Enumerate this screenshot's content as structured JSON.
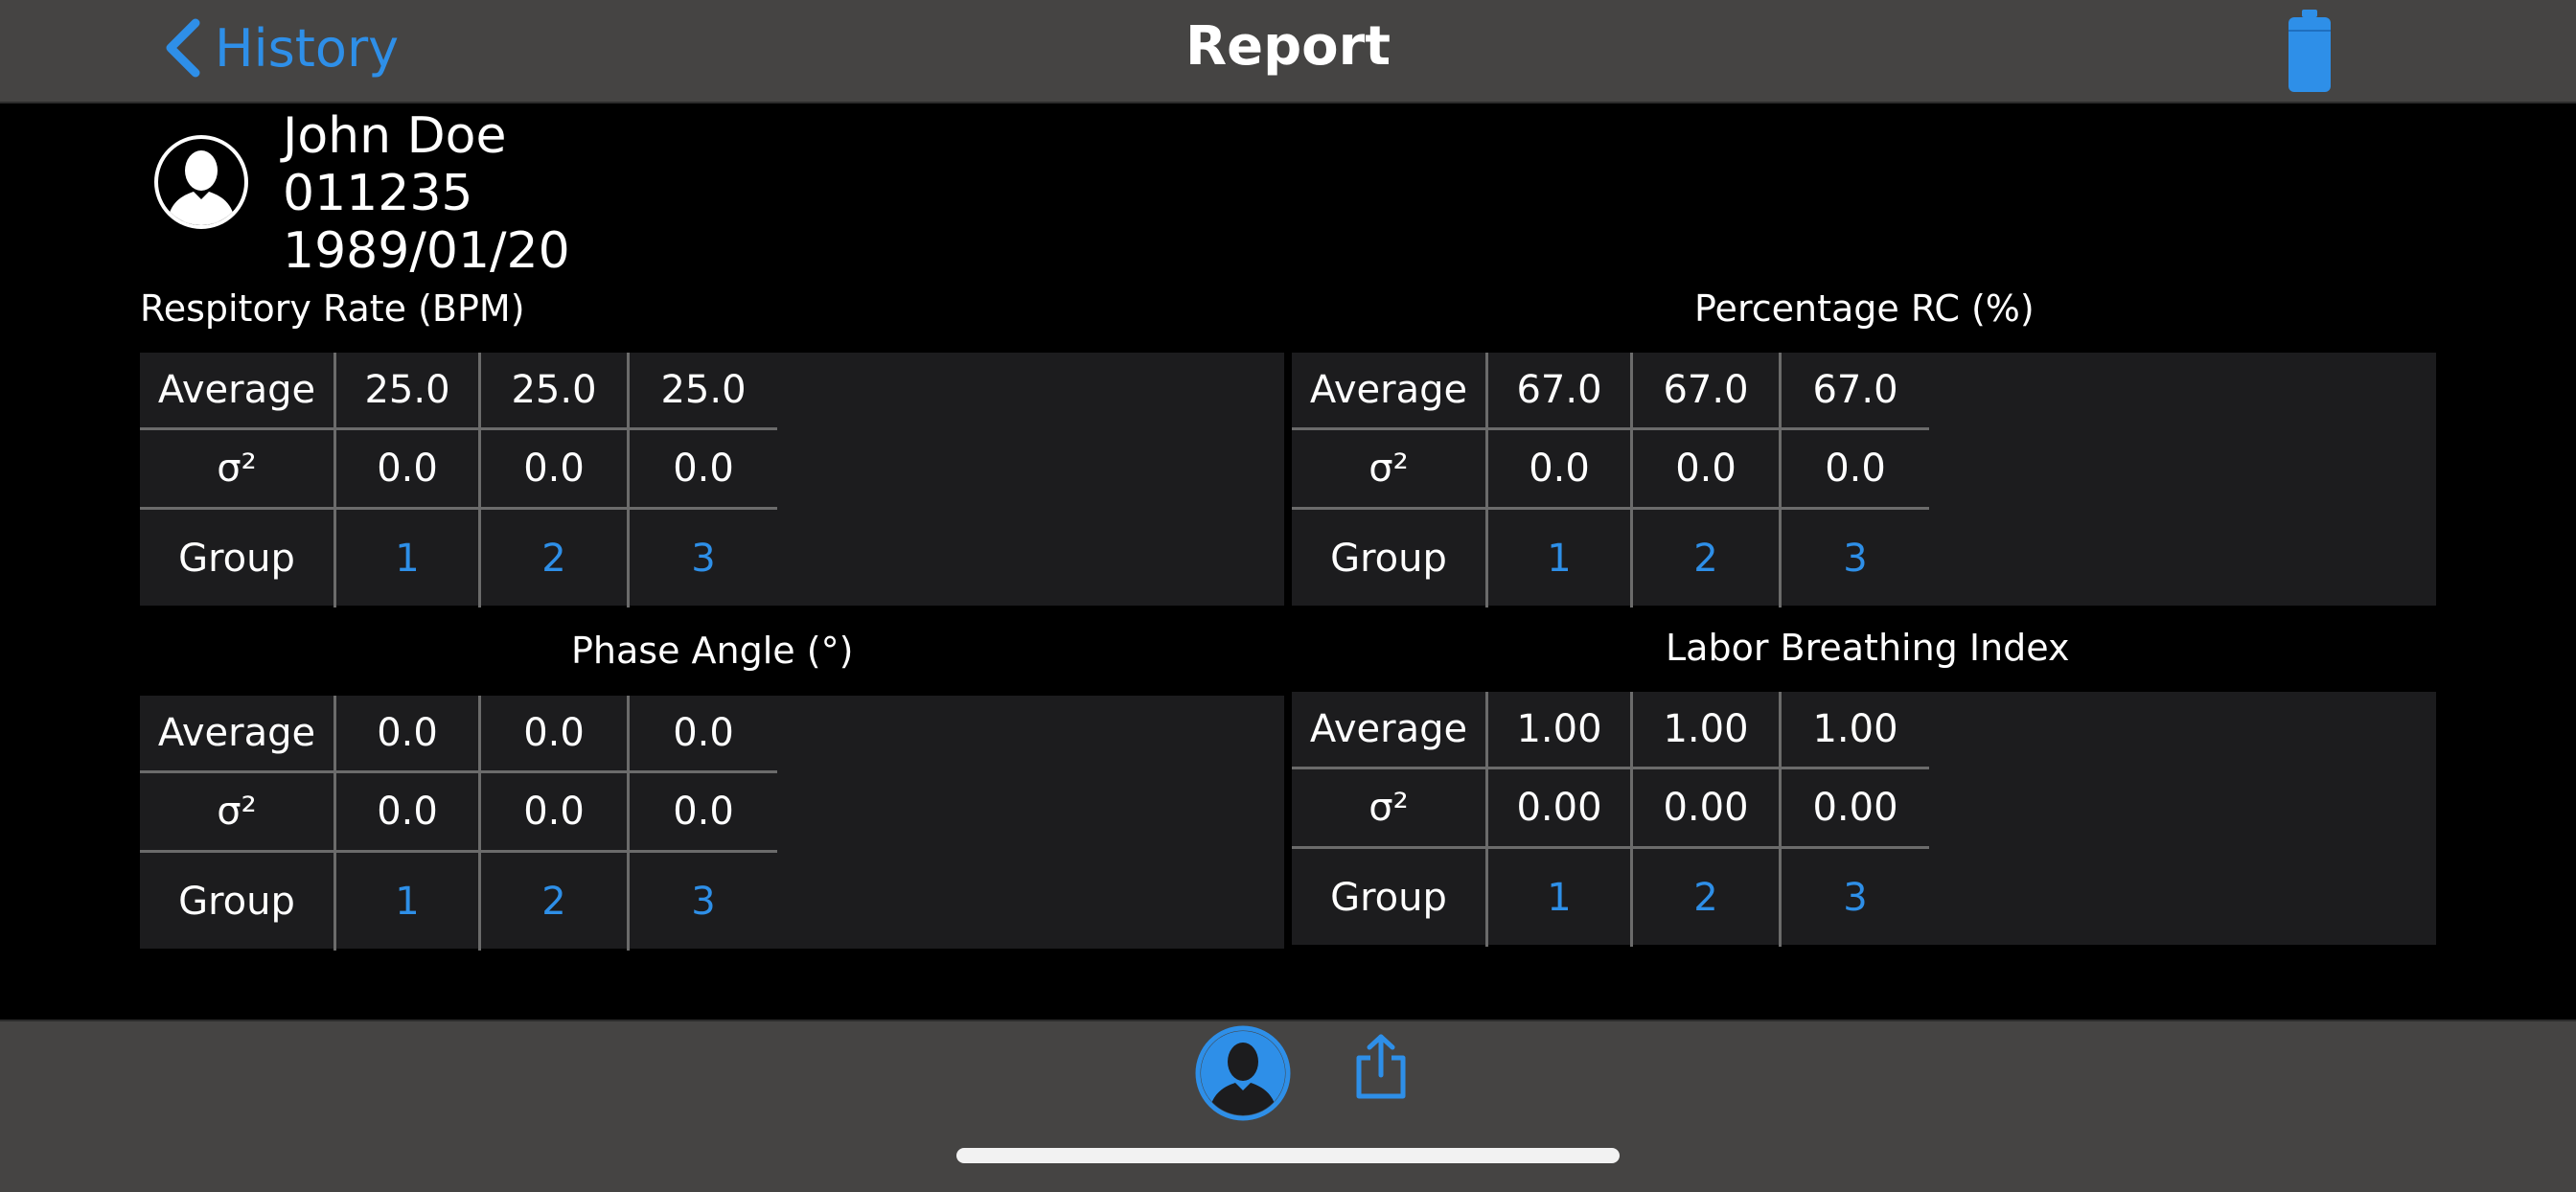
{
  "nav": {
    "back_label": "History",
    "title": "Report"
  },
  "patient": {
    "name": "John Doe",
    "id": "011235",
    "birthdate": "1989/01/20"
  },
  "sections": [
    {
      "title": "Respitory Rate (BPM)",
      "rows": [
        {
          "label": "Average",
          "values": [
            "25.0",
            "25.0",
            "25.0"
          ]
        },
        {
          "label": "σ²",
          "values": [
            "0.0",
            "0.0",
            "0.0"
          ]
        },
        {
          "label": "Group",
          "values": [
            "1",
            "2",
            "3"
          ]
        }
      ]
    },
    {
      "title": "Percentage RC (%)",
      "rows": [
        {
          "label": "Average",
          "values": [
            "67.0",
            "67.0",
            "67.0"
          ]
        },
        {
          "label": "σ²",
          "values": [
            "0.0",
            "0.0",
            "0.0"
          ]
        },
        {
          "label": "Group",
          "values": [
            "1",
            "2",
            "3"
          ]
        }
      ]
    },
    {
      "title": "Phase Angle (°)",
      "rows": [
        {
          "label": "Average",
          "values": [
            "0.0",
            "0.0",
            "0.0"
          ]
        },
        {
          "label": "σ²",
          "values": [
            "0.0",
            "0.0",
            "0.0"
          ]
        },
        {
          "label": "Group",
          "values": [
            "1",
            "2",
            "3"
          ]
        }
      ]
    },
    {
      "title": "Labor Breathing Index",
      "rows": [
        {
          "label": "Average",
          "values": [
            "1.00",
            "1.00",
            "1.00"
          ]
        },
        {
          "label": "σ²",
          "values": [
            "0.00",
            "0.00",
            "0.00"
          ]
        },
        {
          "label": "Group",
          "values": [
            "1",
            "2",
            "3"
          ]
        }
      ]
    }
  ],
  "colors": {
    "accent": "#2e8fe8",
    "bar_bg": "#454443",
    "panel_bg": "#1c1c1e"
  },
  "icons": {
    "back": "chevron-left-icon",
    "battery": "battery-icon",
    "avatar": "person-icon",
    "profile": "person-circle-icon",
    "share": "share-icon"
  }
}
